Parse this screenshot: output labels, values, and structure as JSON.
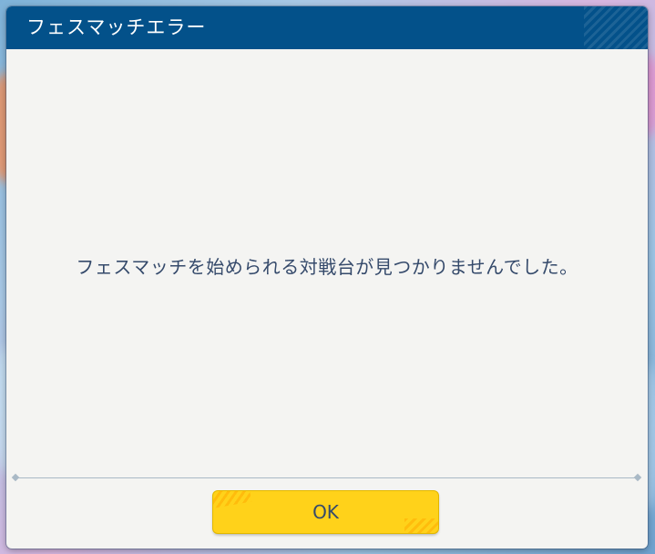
{
  "dialog": {
    "title": "フェスマッチエラー",
    "message": "フェスマッチを始められる対戦台が見つかりませんでした。",
    "ok_label": "OK"
  },
  "colors": {
    "title_bar": "#03518a",
    "dialog_body": "#f4f4f2",
    "message_text": "#354a6b",
    "ok_button": "#ffd21a"
  }
}
